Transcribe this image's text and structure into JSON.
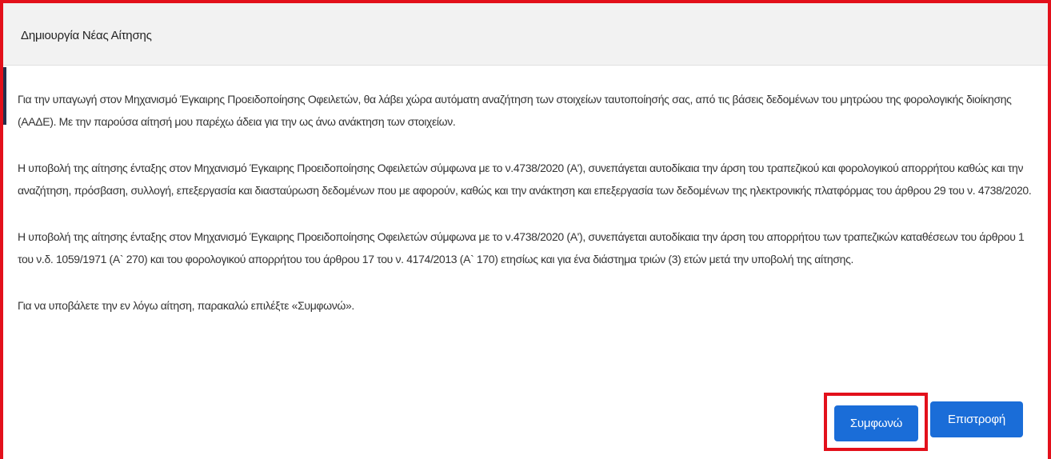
{
  "modal": {
    "title": "Δημιουργία Νέας Αίτησης",
    "paragraphs": [
      "Για την υπαγωγή στον Μηχανισμό Έγκαιρης Προειδοποίησης Οφειλετών, θα λάβει χώρα αυτόματη αναζήτηση των στοιχείων ταυτοποίησής σας, από τις βάσεις δεδομένων του μητρώου της φορολογικής διοίκησης (ΑΑΔΕ). Με την παρούσα αίτησή μου παρέχω άδεια για την ως άνω ανάκτηση των στοιχείων.",
      "Η υποβολή της αίτησης ένταξης στον Μηχανισμό Έγκαιρης Προειδοποίησης Οφειλετών σύμφωνα με το ν.4738/2020 (Α'), συνεπάγεται αυτοδίκαια την άρση του τραπεζικού και φορολογικού απορρήτου καθώς και την αναζήτηση, πρόσβαση, συλλογή, επεξεργασία και διασταύρωση δεδομένων που με αφορούν, καθώς και την ανάκτηση και επεξεργασία των δεδομένων της ηλεκτρονικής πλατφόρμας του άρθρου 29 του ν. 4738/2020.",
      "Η υποβολή της αίτησης ένταξης στον Μηχανισμό Έγκαιρης Προειδοποίησης Οφειλετών σύμφωνα με το ν.4738/2020 (Α'), συνεπάγεται αυτοδίκαια την άρση του απορρήτου των τραπεζικών καταθέσεων του άρθρου 1 του ν.δ. 1059/1971 (Α` 270) και του φορολογικού απορρήτου του άρθρου 17 του ν. 4174/2013 (Α` 170) ετησίως και για ένα διάστημα τριών (3) ετών μετά την υποβολή της αίτησης.",
      "Για να υποβάλετε την εν λόγω αίτηση, παρακαλώ επιλέξτε «Συμφωνώ»."
    ],
    "agree_label": "Συμφωνώ",
    "back_label": "Επιστροφή"
  },
  "colors": {
    "highlight": "#e3101b",
    "button": "#1a6dd8",
    "header_bg": "#f2f2f2"
  }
}
